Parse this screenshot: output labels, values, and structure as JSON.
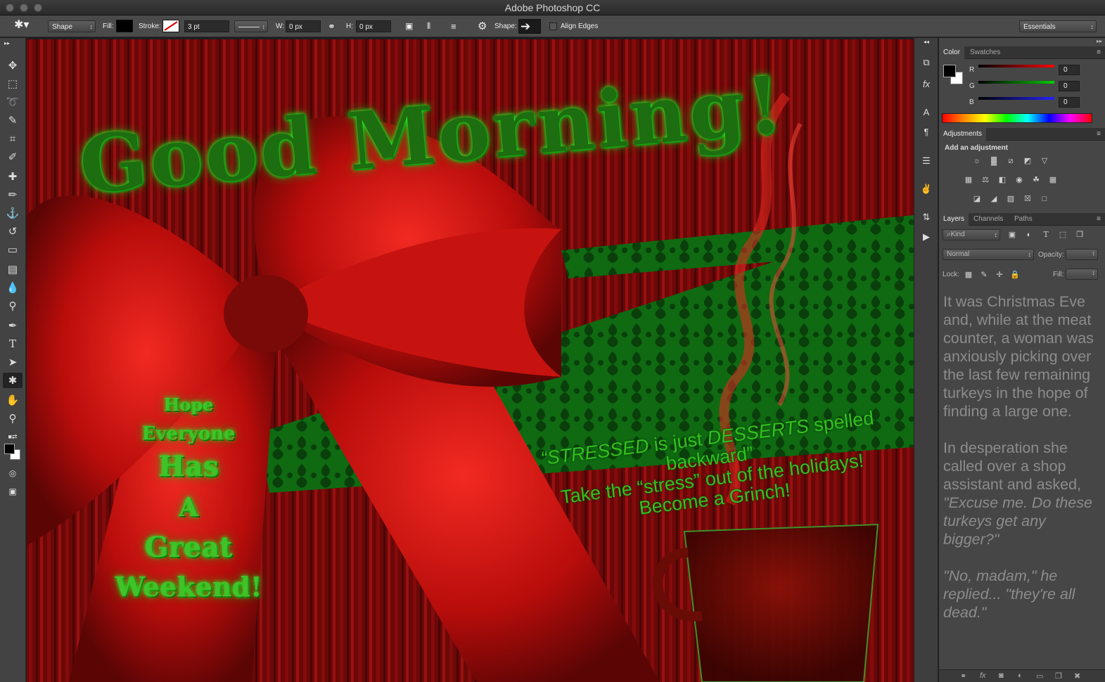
{
  "window": {
    "title": "Adobe Photoshop CC"
  },
  "options": {
    "mode": "Shape",
    "fill_label": "Fill:",
    "stroke_label": "Stroke:",
    "stroke_width": "3 pt",
    "w_label": "W:",
    "w_value": "0 px",
    "h_label": "H:",
    "h_value": "0 px",
    "shape_label": "Shape:",
    "align_edges": "Align Edges",
    "workspace": "Essentials"
  },
  "tools": [
    "move-tool",
    "marquee-tool",
    "lasso-tool",
    "quick-select-tool",
    "crop-tool",
    "eyedropper-tool",
    "healing-brush-tool",
    "brush-tool",
    "clone-stamp-tool",
    "history-brush-tool",
    "eraser-tool",
    "gradient-tool",
    "blur-tool",
    "dodge-tool",
    "pen-tool",
    "type-tool",
    "path-select-tool",
    "custom-shape-tool",
    "hand-tool",
    "zoom-tool"
  ],
  "canvas": {
    "headline": "Good Morning!",
    "side_words": [
      "Hope",
      "Everyone",
      "Has",
      "A",
      "Great",
      "Weekend!"
    ],
    "quote_line1_a": "“STRESSED",
    "quote_line1_b": " is just ",
    "quote_line1_c": "DESSERTS",
    "quote_line1_d": " spelled backward”",
    "quote_line2": "Take the “stress” out of the holidays!",
    "quote_line3": "Become a Grinch!"
  },
  "color_panel": {
    "tabs": [
      "Color",
      "Swatches"
    ],
    "r_label": "R",
    "r_value": "0",
    "g_label": "G",
    "g_value": "0",
    "b_label": "B",
    "b_value": "0"
  },
  "adjustments_panel": {
    "tab": "Adjustments",
    "subtitle": "Add an adjustment"
  },
  "layers_panel": {
    "tabs": [
      "Layers",
      "Channels",
      "Paths"
    ],
    "kind": "Kind",
    "blend_mode": "Normal",
    "opacity_label": "Opacity:",
    "lock_label": "Lock:",
    "fill_label": "Fill:"
  },
  "story": {
    "p1": "It was Christmas Eve and, while at the meat counter, a woman was anxiously picking over the last few remaining turkeys in the hope of finding a large one.",
    "p2a": "In desperation she called over a shop assistant and asked, ",
    "p2b": "\"Excuse me. Do these turkeys get any bigger?\"",
    "p3": "\"No, madam,\" he replied... \"they're all dead.\""
  },
  "colors": {
    "ui_dark": "#1e1e1e",
    "panel": "#464646",
    "accent_green": "#41c22a",
    "ribbon_red": "#c0100e"
  }
}
